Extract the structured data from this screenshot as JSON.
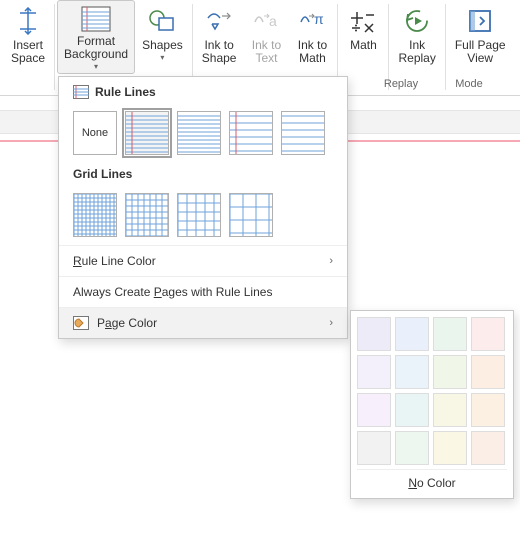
{
  "ribbon": {
    "insert_space": "Insert\nSpace",
    "format_background": "Format\nBackground",
    "shapes": "Shapes",
    "ink_to_shape": "Ink to\nShape",
    "ink_to_text": "Ink to\nText",
    "ink_to_math": "Ink to\nMath",
    "math": "Math",
    "ink_replay": "Ink\nReplay",
    "full_page_view": "Full Page\nView"
  },
  "groups": {
    "replay": "Replay",
    "mode": "Mode"
  },
  "dropdown": {
    "rule_lines_heading": "Rule Lines",
    "grid_lines_heading": "Grid Lines",
    "none_label": "None",
    "rule_line_color": "Rule Line Color",
    "always_rule_lines": "Always Create Pages with Rule Lines",
    "page_color": "Page Color",
    "rule_styles": [
      {
        "id": "rule-none",
        "kind": "none"
      },
      {
        "id": "rule-narrow-margin",
        "kind": "rule",
        "margin": true,
        "spacing": 4
      },
      {
        "id": "rule-narrow",
        "kind": "rule",
        "margin": false,
        "spacing": 4
      },
      {
        "id": "rule-wide-margin",
        "kind": "rule",
        "margin": true,
        "spacing": 7
      },
      {
        "id": "rule-wide",
        "kind": "rule",
        "margin": false,
        "spacing": 7
      }
    ],
    "grid_styles": [
      {
        "id": "grid-small",
        "spacing": 4
      },
      {
        "id": "grid-medium",
        "spacing": 6
      },
      {
        "id": "grid-large",
        "spacing": 9
      },
      {
        "id": "grid-xlarge",
        "spacing": 13
      }
    ]
  },
  "page_colors": {
    "no_color": "No Color",
    "hotkey": "N",
    "cells": [
      "#ecebf7",
      "#eaf0fb",
      "#e9f5ed",
      "#fdecec",
      "#f3f0fb",
      "#eaf3f9",
      "#f0f7e8",
      "#fdeee4",
      "#f7effb",
      "#e8f5f4",
      "#f8f7e6",
      "#fbf0e1",
      "#f2f2f2",
      "#eef6f0",
      "#fbf7e5",
      "#faeee6"
    ]
  }
}
